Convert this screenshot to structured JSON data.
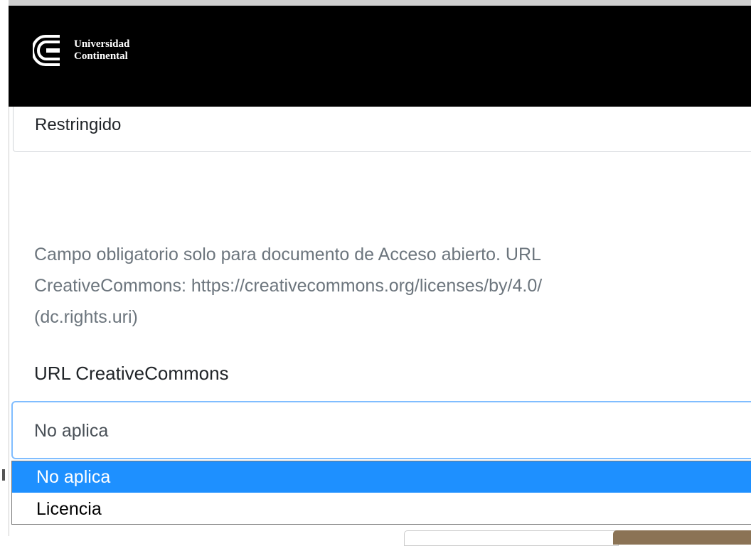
{
  "header": {
    "logo": {
      "line1": "Universidad",
      "line2": "Continental",
      "icon": "continental-logo-icon"
    },
    "background": "#000000"
  },
  "access_field": {
    "value": "Restringido"
  },
  "license_help": {
    "line1": "Campo obligatorio solo para documento de Acceso abierto. URL",
    "line2": "CreativeCommons: https://creativecommons.org/licenses/by/4.0/",
    "line3": "(dc.rights.uri)"
  },
  "license_field": {
    "label": "URL CreativeCommons",
    "selected_value": "No aplica",
    "options": [
      "No aplica",
      "Licencia"
    ]
  },
  "colors": {
    "focus_border": "#80bdff",
    "option_highlight": "#1e90ff",
    "help_text": "#6c757d",
    "bottom_button": "#8b7355"
  }
}
